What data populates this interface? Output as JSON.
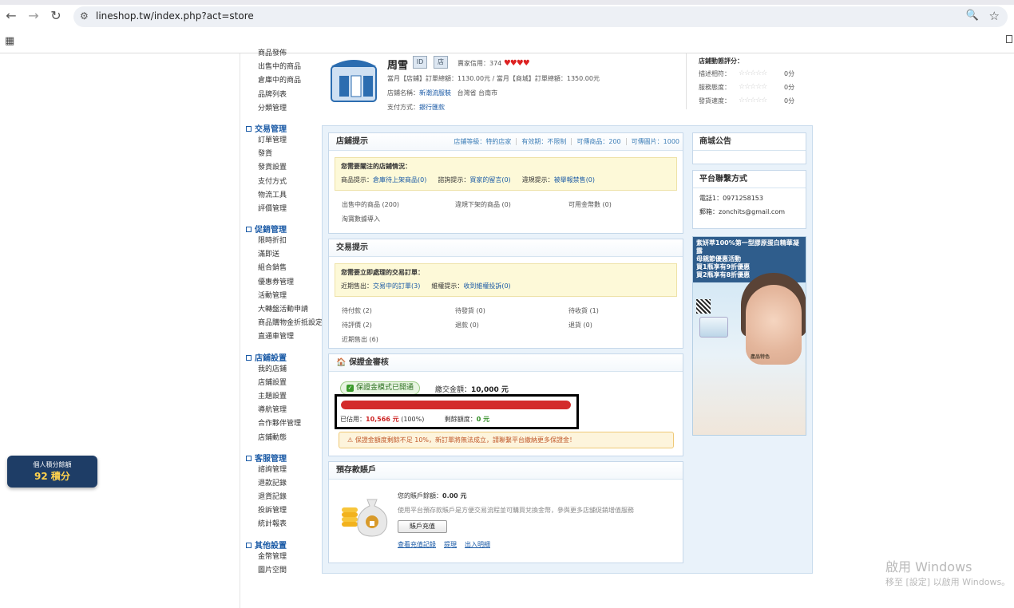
{
  "browser": {
    "url": "lineshop.tw/index.php?act=store"
  },
  "sidebar": {
    "top_items": [
      "商品發佈",
      "出售中的商品",
      "倉庫中的商品",
      "品牌列表",
      "分類管理"
    ],
    "groups": [
      {
        "title": "交易管理",
        "items": [
          "訂單管理",
          "發貨",
          "發貨設置",
          "支付方式",
          "物流工具",
          "評價管理"
        ]
      },
      {
        "title": "促銷管理",
        "items": [
          "限時折扣",
          "滿即送",
          "組合銷售",
          "優惠券管理",
          "活動管理",
          "大轉盤活動申請",
          "商品購物金折抵設定",
          "直通車管理"
        ]
      },
      {
        "title": "店鋪設置",
        "items": [
          "我的店鋪",
          "店鋪設置",
          "主題設置",
          "導航管理",
          "合作夥伴管理",
          "店鋪動態"
        ]
      },
      {
        "title": "客服管理",
        "items": [
          "諮詢管理",
          "退款記錄",
          "退貨記錄",
          "投訴管理",
          "統計報表"
        ]
      },
      {
        "title": "其他設置",
        "items": [
          "金幣管理",
          "圖片空間"
        ]
      }
    ]
  },
  "points_widget": {
    "label": "個人積分餘額",
    "value": "92 積分"
  },
  "store": {
    "name": "周雪",
    "seller_rating_label": "賣家信用：374",
    "hearts": "♥♥♥♥",
    "monthly_line": "當月【店鋪】訂單總額：1130.00元 / 當月【商城】訂單總額：1350.00元",
    "shop_name_label": "店鋪名稱：",
    "shop_name": "新潮流服裝",
    "shop_location": "台灣省 台南市",
    "payment_label": "支付方式：",
    "payment_method": "銀行匯款",
    "rating_title": "店鋪動態評分：",
    "ratings": [
      {
        "label": "描述相符：",
        "stars": "☆☆☆☆☆",
        "score": "0分"
      },
      {
        "label": "服務態度：",
        "stars": "☆☆☆☆☆",
        "score": "0分"
      },
      {
        "label": "發貨速度：",
        "stars": "☆☆☆☆☆",
        "score": "0分"
      }
    ]
  },
  "store_tips": {
    "title": "店鋪提示",
    "stats": [
      "店鋪等級：特約店家",
      "有效期：不限制",
      "可傳商品：200",
      "可傳圖片：1000"
    ],
    "notice_title": "您需要關注的店鋪情況：",
    "notice_items": [
      {
        "prefix": "商品提示：",
        "link": "倉庫待上架商品",
        "count": "(0)"
      },
      {
        "prefix": "諮詢提示：",
        "link": "買家的留言",
        "count": "(0)"
      },
      {
        "prefix": "違規提示：",
        "link": "被舉報禁售",
        "count": "(0)"
      }
    ],
    "grid": [
      "出售中的商品 (200)",
      "違規下架的商品 (0)",
      "可用金幣數 (0)",
      "淘寶數據導入"
    ]
  },
  "trade_tips": {
    "title": "交易提示",
    "notice_title": "您需要立即處理的交易訂單：",
    "notice_items": [
      {
        "prefix": "近期售出：",
        "link": "交易中的訂單",
        "count": "(3)"
      },
      {
        "prefix": "維權提示：",
        "link": "收到維權投訴",
        "count": "(0)"
      }
    ],
    "grid": [
      "待付款 (2)",
      "待發貨 (0)",
      "待收貨 (1)",
      "待評價 (2)",
      "退款 (0)",
      "退貨 (0)",
      "近期售出 (6)"
    ]
  },
  "deposit": {
    "title": "保證金審核",
    "badge": "保證金模式已開通",
    "paid_label": "繳交金額：",
    "paid_value": "10,000 元",
    "used_label": "已佔用：",
    "used_value": "10,566 元",
    "used_pct": "(100%)",
    "used_fraction": 1.0,
    "remaining_label": "剩餘額度：",
    "remaining_value": "0 元",
    "warning": "⚠ 保證金額度剩餘不足 10%，新訂單將無法成立，請聯繫平台繳納更多保證金！",
    "bar_color": "#d32b2b"
  },
  "prepaid": {
    "title": "預存款賬戶",
    "balance_label": "您的賬戶餘額：",
    "balance_value": "0.00 元",
    "description": "使用平台預存款賬戶是方便交易流程並可購買兌換金幣，參與更多店舖促銷增值服務",
    "topup_button": "賬戶充值",
    "links": [
      "查看充值記錄",
      "提現",
      "出入明細"
    ]
  },
  "announcement": {
    "title": "商城公告"
  },
  "contact": {
    "title": "平台聯繫方式",
    "phone": "電話1：0971258153",
    "email": "郵箱：zonchits@gmail.com"
  },
  "ad": {
    "line1": "紫妍萃100%第一型膠原蛋白精華凝露",
    "line2": "母親節優惠活動",
    "line3": "買1瓶享有9折優惠",
    "line4": "買2瓶享有8折優惠",
    "feature_title": "產品特色"
  },
  "watermark": {
    "line1": "啟用 Windows",
    "line2": "移至 [設定] 以啟用 Windows。"
  }
}
